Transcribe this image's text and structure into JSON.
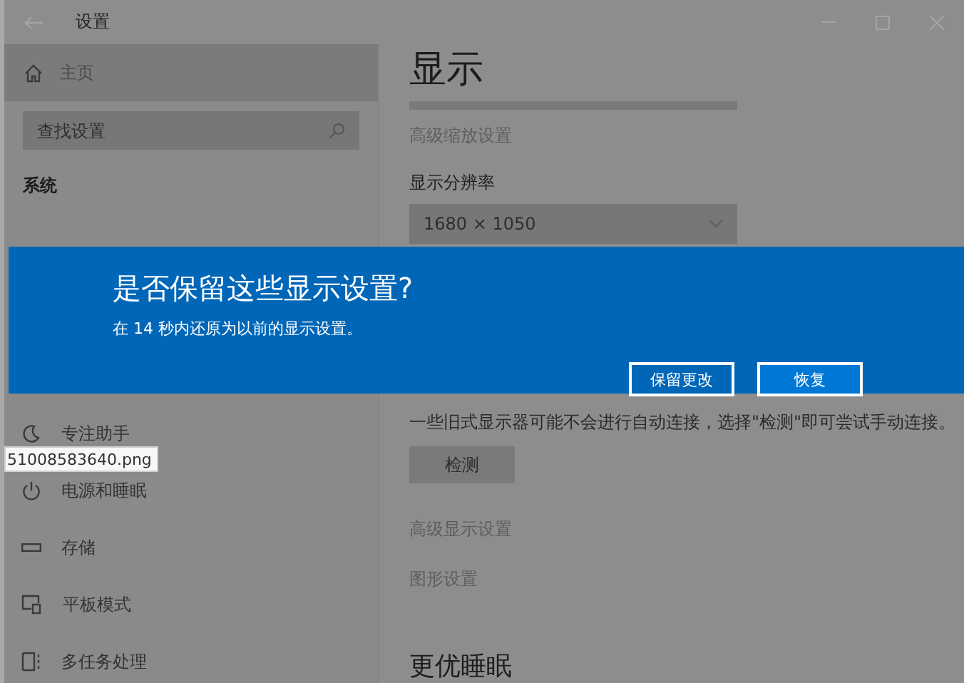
{
  "window": {
    "title": "设置"
  },
  "sidebar": {
    "home": "主页",
    "search": {
      "placeholder": "查找设置"
    },
    "section": "系统",
    "items": [
      {
        "label": "专注助手"
      },
      {
        "label": "电源和睡眠"
      },
      {
        "label": "存储"
      },
      {
        "label": "平板模式"
      },
      {
        "label": "多任务处理"
      }
    ]
  },
  "main": {
    "title": "显示",
    "scale_link": "高级缩放设置",
    "resolution": {
      "label": "显示分辨率",
      "value": "1680 × 1050"
    },
    "detect_note": "一些旧式显示器可能不会进行自动连接，选择\"检测\"即可尝试手动连接。",
    "detect_button": "检测",
    "links": [
      "高级显示设置",
      "图形设置"
    ],
    "next_heading": "更优睡眠"
  },
  "dialog": {
    "title": "是否保留这些显示设置?",
    "message": "在 14 秒内还原为以前的显示设置。",
    "buttons": [
      {
        "label": "保留更改",
        "kind": "secondary"
      },
      {
        "label": "恢复",
        "kind": "primary"
      }
    ]
  },
  "tooltip": {
    "text": "51008583640.png"
  }
}
